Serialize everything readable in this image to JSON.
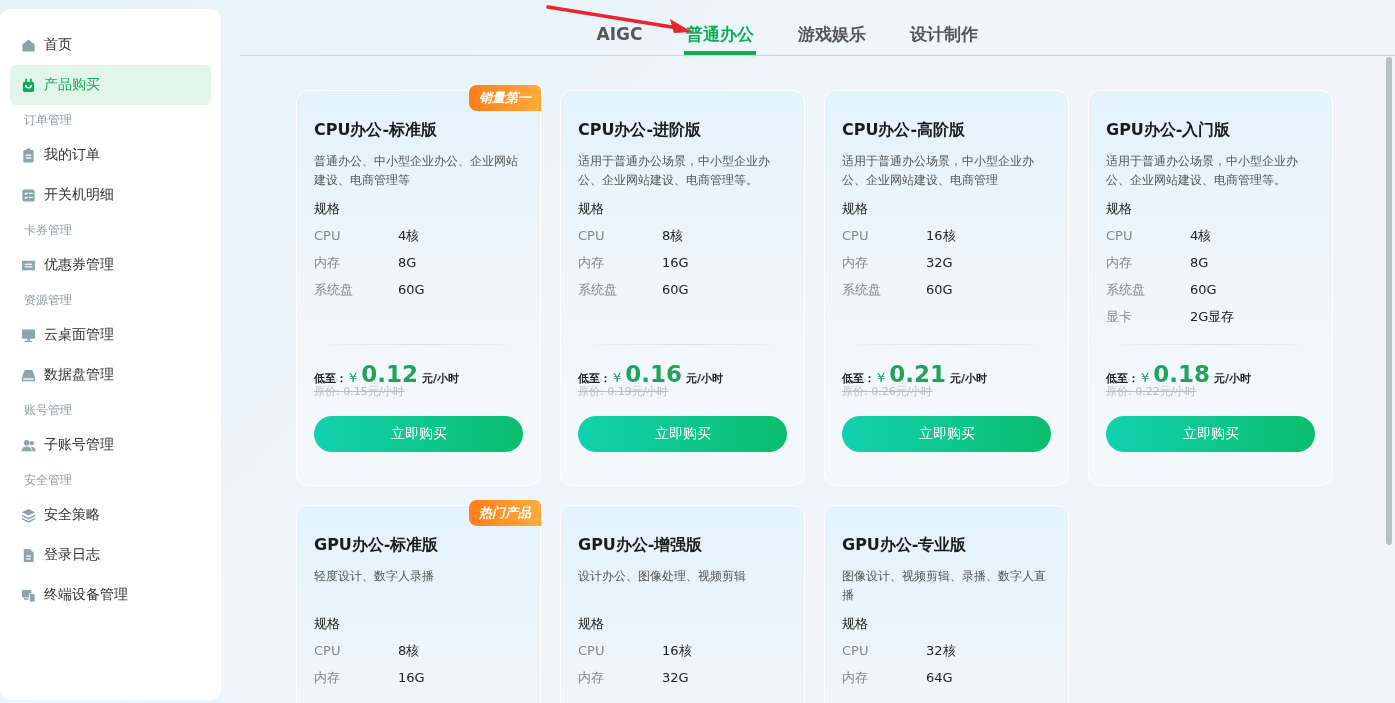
{
  "sidebar": {
    "items": [
      {
        "kind": "item",
        "label": "首页",
        "selected": false
      },
      {
        "kind": "item",
        "label": "产品购买",
        "selected": true
      },
      {
        "kind": "section",
        "label": "订单管理"
      },
      {
        "kind": "item",
        "label": "我的订单",
        "selected": false
      },
      {
        "kind": "item",
        "label": "开关机明细",
        "selected": false
      },
      {
        "kind": "section",
        "label": "卡券管理"
      },
      {
        "kind": "item",
        "label": "优惠券管理",
        "selected": false
      },
      {
        "kind": "section",
        "label": "资源管理"
      },
      {
        "kind": "item",
        "label": "云桌面管理",
        "selected": false
      },
      {
        "kind": "item",
        "label": "数据盘管理",
        "selected": false
      },
      {
        "kind": "section",
        "label": "账号管理"
      },
      {
        "kind": "item",
        "label": "子账号管理",
        "selected": false
      },
      {
        "kind": "section",
        "label": "安全管理"
      },
      {
        "kind": "item",
        "label": "安全策略",
        "selected": false
      },
      {
        "kind": "item",
        "label": "登录日志",
        "selected": false
      },
      {
        "kind": "item",
        "label": "终端设备管理",
        "selected": false
      }
    ]
  },
  "tabs": [
    {
      "label": "AIGC",
      "selected": false
    },
    {
      "label": "普通办公",
      "selected": true
    },
    {
      "label": "游戏娱乐",
      "selected": false
    },
    {
      "label": "设计制作",
      "selected": false
    }
  ],
  "annotation_arrow": {
    "kind": "arrow"
  },
  "cards": [
    {
      "badge": "销量第一",
      "title": "CPU办公-标准版",
      "description": "普通办公、中小型企业办公、企业网站建设、电商管理等",
      "spec_heading": "规格",
      "specs": [
        {
          "label": "CPU",
          "value": "4核"
        },
        {
          "label": "内存",
          "value": "8G"
        },
        {
          "label": "系统盘",
          "value": "60G"
        }
      ],
      "price": {
        "prefix": "低至：",
        "currency": "¥",
        "amount": "0.12",
        "unit": "元/小时",
        "original": "原价: 0.15元/小时"
      },
      "button": "立即购买"
    },
    {
      "title": "CPU办公-进阶版",
      "description": "适用于普通办公场景，中小型企业办公、企业网站建设、电商管理等。",
      "spec_heading": "规格",
      "specs": [
        {
          "label": "CPU",
          "value": "8核"
        },
        {
          "label": "内存",
          "value": "16G"
        },
        {
          "label": "系统盘",
          "value": "60G"
        }
      ],
      "price": {
        "prefix": "低至：",
        "currency": "¥",
        "amount": "0.16",
        "unit": "元/小时",
        "original": "原价: 0.19元/小时"
      },
      "button": "立即购买"
    },
    {
      "title": "CPU办公-高阶版",
      "description": "适用于普通办公场景，中小型企业办公、企业网站建设、电商管理",
      "spec_heading": "规格",
      "specs": [
        {
          "label": "CPU",
          "value": "16核"
        },
        {
          "label": "内存",
          "value": "32G"
        },
        {
          "label": "系统盘",
          "value": "60G"
        }
      ],
      "price": {
        "prefix": "低至：",
        "currency": "¥",
        "amount": "0.21",
        "unit": "元/小时",
        "original": "原价: 0.26元/小时"
      },
      "button": "立即购买"
    },
    {
      "title": "GPU办公-入门版",
      "description": "适用于普通办公场景，中小型企业办公、企业网站建设、电商管理等。",
      "spec_heading": "规格",
      "specs": [
        {
          "label": "CPU",
          "value": "4核"
        },
        {
          "label": "内存",
          "value": "8G"
        },
        {
          "label": "系统盘",
          "value": "60G"
        },
        {
          "label": "显卡",
          "value": "2G显存"
        }
      ],
      "price": {
        "prefix": "低至：",
        "currency": "¥",
        "amount": "0.18",
        "unit": "元/小时",
        "original": "原价: 0.22元/小时"
      },
      "button": "立即购买"
    },
    {
      "badge": "热门产品",
      "title": "GPU办公-标准版",
      "description": "轻度设计、数字人录播",
      "spec_heading": "规格",
      "specs": [
        {
          "label": "CPU",
          "value": "8核"
        },
        {
          "label": "内存",
          "value": "16G"
        }
      ]
    },
    {
      "title": "GPU办公-增强版",
      "description": "设计办公、图像处理、视频剪辑",
      "spec_heading": "规格",
      "specs": [
        {
          "label": "CPU",
          "value": "16核"
        },
        {
          "label": "内存",
          "value": "32G"
        }
      ]
    },
    {
      "title": "GPU办公-专业版",
      "description": "图像设计、视频剪辑、录播、数字人直播",
      "spec_heading": "规格",
      "specs": [
        {
          "label": "CPU",
          "value": "32核"
        },
        {
          "label": "内存",
          "value": "64G"
        }
      ]
    }
  ]
}
